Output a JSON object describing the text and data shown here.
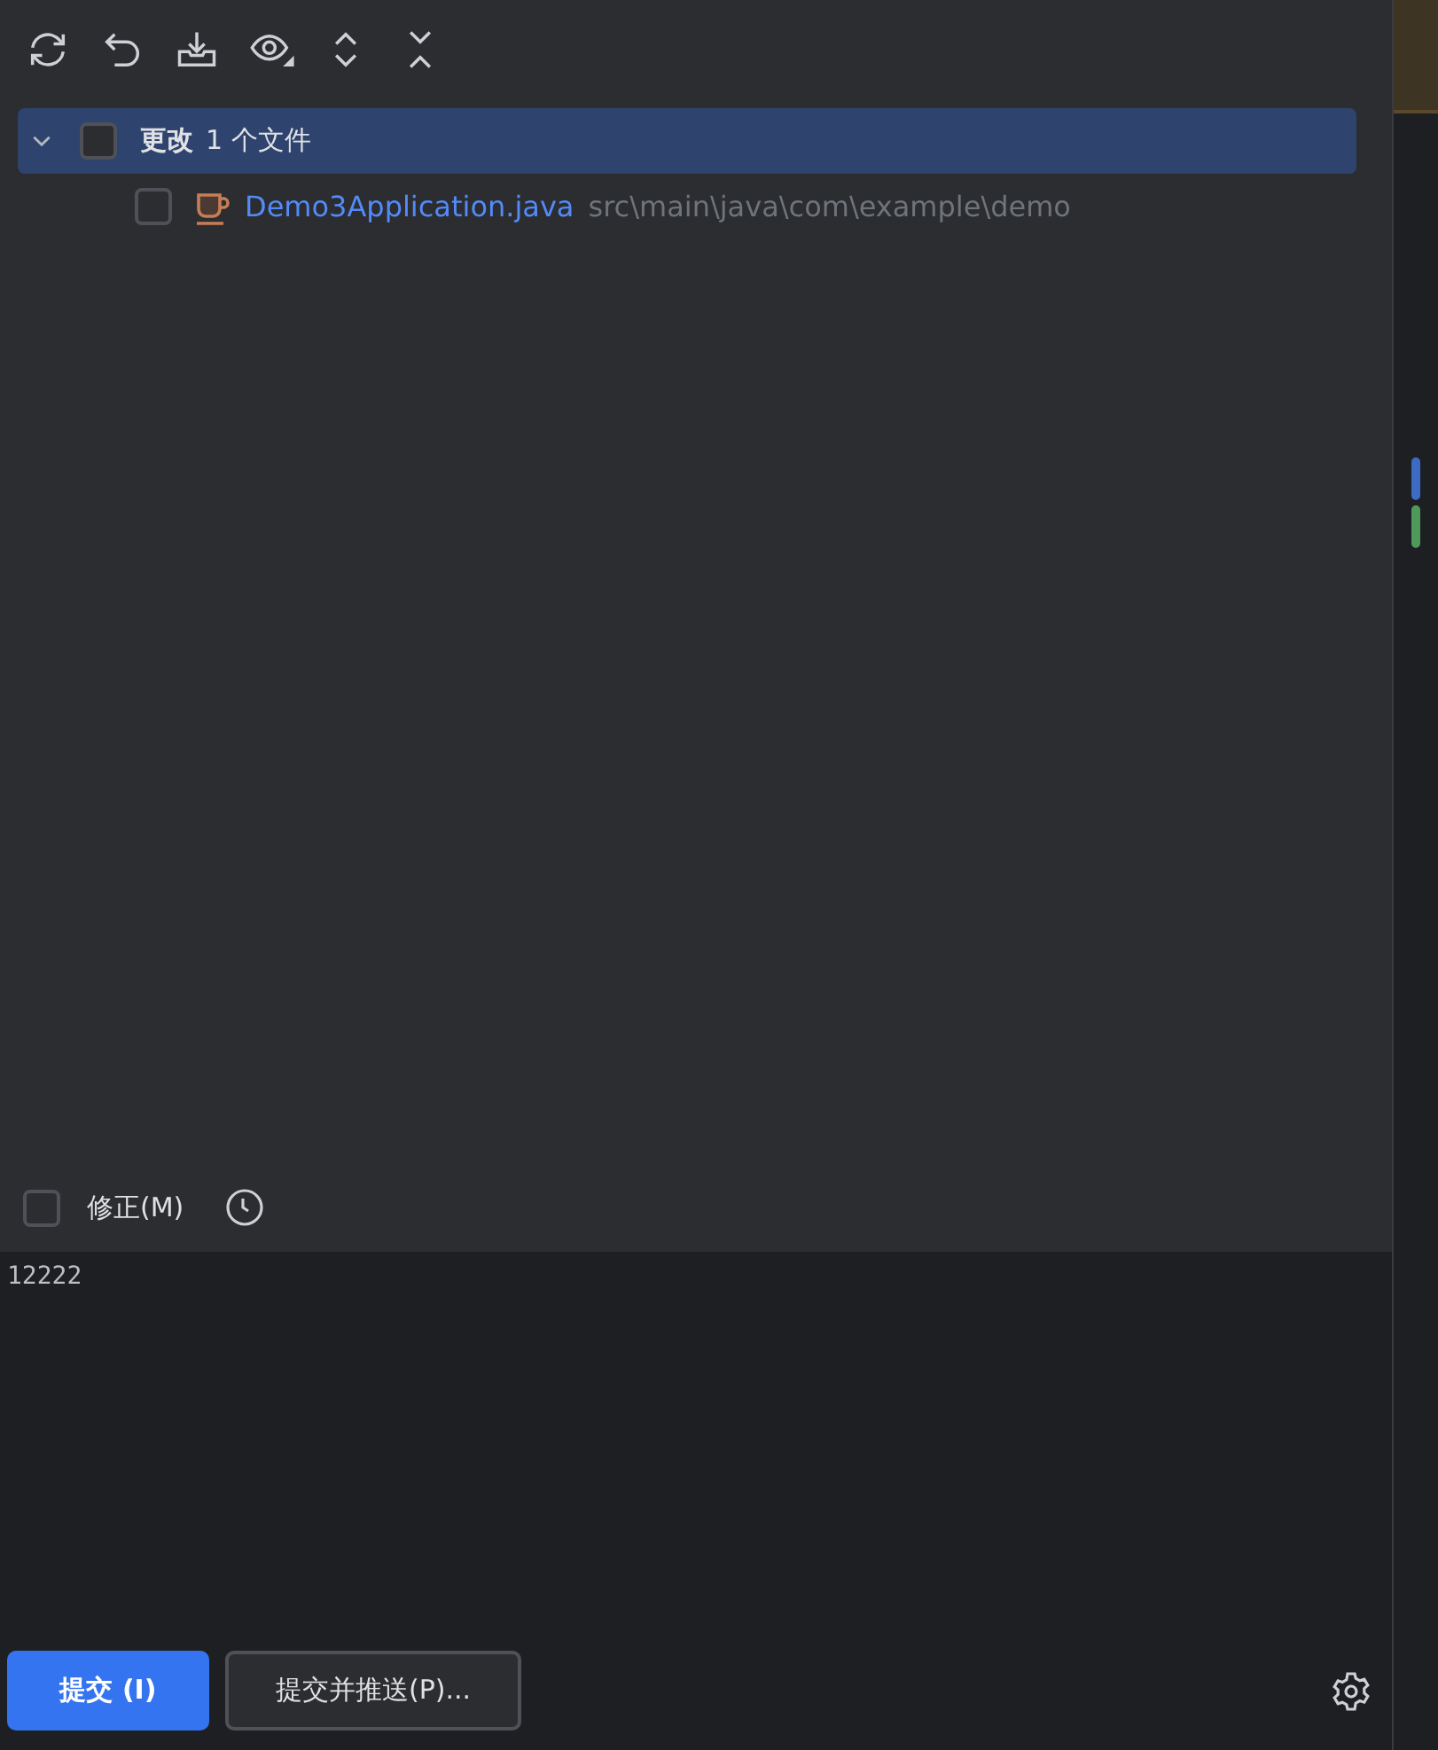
{
  "toolbar": [
    {
      "kind": "refresh"
    },
    {
      "kind": "rollback"
    },
    {
      "kind": "shelve"
    },
    {
      "kind": "view"
    },
    {
      "kind": "expand"
    },
    {
      "kind": "collapse"
    }
  ],
  "tree": {
    "label": "更改",
    "count": "1 个文件",
    "expanded": true,
    "selected": true,
    "checked": false,
    "children": [
      {
        "name": "Demo3Application.java",
        "path": "src\\main\\java\\com\\example\\demo",
        "checked": false,
        "selected": false
      }
    ]
  },
  "amend": {
    "label": "修正(M)",
    "checked": false
  },
  "message": {
    "value": "12222"
  },
  "buttons": [
    {
      "label": "提交 (I)",
      "kind": "primary"
    },
    {
      "label": "提交并推送(P)...",
      "kind": "secondary"
    }
  ],
  "change_markers": [
    {
      "color": "#3d6bc4"
    },
    {
      "color": "#4f9a5a"
    }
  ]
}
